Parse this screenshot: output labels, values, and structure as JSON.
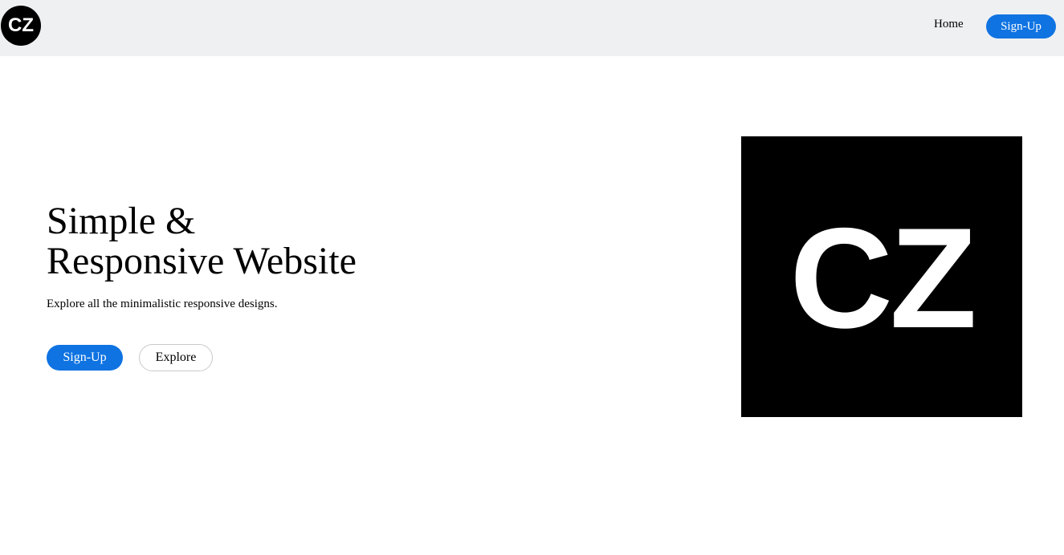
{
  "navbar": {
    "logo_text": "CZ",
    "home_label": "Home",
    "signup_label": "Sign-Up",
    "background_color": "#eff0f2"
  },
  "hero": {
    "title_line1": "Simple &",
    "title_line2": "Responsive Website",
    "subtitle": "Explore all the minimalistic responsive designs.",
    "signup_label": "Sign-Up",
    "explore_label": "Explore",
    "image_text": "CZ"
  },
  "colors": {
    "accent": "#0f73e2",
    "logo_background": "#000000",
    "logo_text": "#ffffff"
  }
}
